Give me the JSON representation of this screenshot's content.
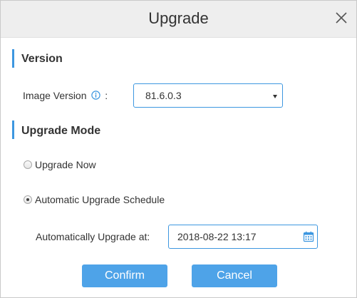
{
  "dialog": {
    "title": "Upgrade",
    "close_icon": "close-icon"
  },
  "version_section": {
    "title": "Version",
    "image_version_label": "Image Version",
    "info_icon": "info-icon",
    "label_colon": ":",
    "image_version_value": "81.6.0.3"
  },
  "upgrade_mode_section": {
    "title": "Upgrade Mode",
    "options": [
      {
        "label": "Upgrade Now",
        "selected": false
      },
      {
        "label": "Automatic Upgrade Schedule",
        "selected": true
      }
    ],
    "schedule_label": "Automatically Upgrade at:",
    "schedule_value": "2018-08-22 13:17",
    "calendar_icon": "calendar-icon"
  },
  "footer": {
    "confirm_label": "Confirm",
    "cancel_label": "Cancel"
  },
  "colors": {
    "accent": "#3d97e0",
    "button": "#4ea3e8",
    "titlebar": "#eeeeee"
  }
}
